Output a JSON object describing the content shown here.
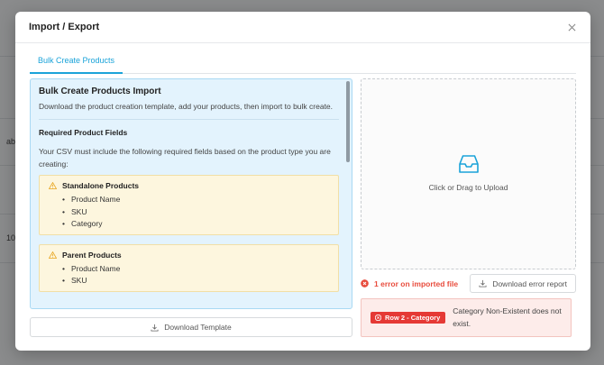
{
  "background": {
    "row_texts": [
      "ab",
      "10"
    ]
  },
  "modal": {
    "title": "Import / Export",
    "close_icon": "close-icon"
  },
  "tabs": [
    {
      "label": "Bulk Create Products",
      "active": true
    }
  ],
  "info_panel": {
    "title": "Bulk Create Products Import",
    "description": "Download the product creation template, add your products, then import to bulk create.",
    "required_title": "Required Product Fields",
    "required_description": "Your CSV must include the following required fields based on the product type you are creating:",
    "groups": [
      {
        "title": "Standalone Products",
        "icon": "warning-icon",
        "fields": [
          "Product Name",
          "SKU",
          "Category"
        ]
      },
      {
        "title": "Parent Products",
        "icon": "warning-icon",
        "fields": [
          "Product Name",
          "SKU"
        ]
      }
    ]
  },
  "buttons": {
    "download_template": "Download Template",
    "download_error_report": "Download error report"
  },
  "upload": {
    "label": "Click or Drag to Upload",
    "icon": "inbox-icon"
  },
  "errors": {
    "summary": "1 error on imported file",
    "items": [
      {
        "badge": "Row 2 - Category",
        "message": "Category Non-Existent does not exist."
      }
    ]
  },
  "colors": {
    "accent": "#1aa3d9",
    "error": "#e53935",
    "info_bg": "#e3f3fd",
    "warning_bg": "#fdf6de"
  }
}
